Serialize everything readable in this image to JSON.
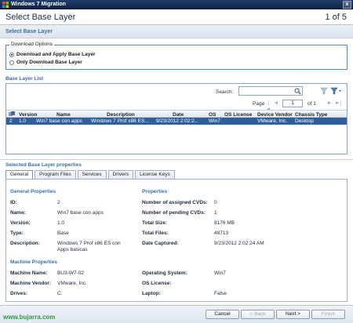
{
  "window": {
    "title": "Windows 7 Migration",
    "close_glyph": "x"
  },
  "header": {
    "title": "Select Base Layer",
    "step": "1 of 5"
  },
  "band": {
    "title": "Select Base Layer"
  },
  "download_options": {
    "legend": "Download Options",
    "options": [
      {
        "label": "Download and Apply Base Layer",
        "selected": true
      },
      {
        "label": "Only Download Base Layer",
        "selected": false
      }
    ]
  },
  "base_layer_list": {
    "title": "Base Layer List",
    "search_label": "Search:",
    "search_value": "",
    "pager": {
      "label": "Page",
      "first": "|◄",
      "prev": "◄",
      "page": "1",
      "of": "of 1",
      "next": "►",
      "last": "►|"
    },
    "columns": [
      "",
      "Version",
      "Name",
      "Description",
      "Date",
      "OS",
      "OS License",
      "Device Vendor",
      "Chassis Type"
    ],
    "rows": [
      [
        "2",
        "1.0",
        "Win7 base con apps",
        "Windows 7 Prof x86 ES...",
        "9/23/2012 2:02:2...",
        "Win7",
        "",
        "VMware, Inc.",
        "Desktop"
      ]
    ]
  },
  "selected_props": {
    "title": "Selected Base Layer properties",
    "tabs": [
      "General",
      "Program Files",
      "Services",
      "Drivers",
      "License Keys"
    ],
    "active_tab": "General",
    "general_heading": "General Properties",
    "properties_heading": "Properties",
    "machine_heading": "Machine Properties",
    "general": [
      {
        "k": "ID:",
        "v": "2"
      },
      {
        "k": "Name:",
        "v": "Win7 base con apps"
      },
      {
        "k": "Version:",
        "v": "1.0"
      },
      {
        "k": "Type:",
        "v": "Base"
      },
      {
        "k": "Description:",
        "v": "Windows 7 Prof x86 ES con",
        "v2": "Apps basicas"
      }
    ],
    "properties": [
      {
        "k": "Number of assigned CVDs:",
        "v": "0"
      },
      {
        "k": "Number of pending CVDs:",
        "v": "1"
      },
      {
        "k": "Total Size:",
        "v": "8176 MB"
      },
      {
        "k": "Total Files:",
        "v": "48713"
      },
      {
        "k": "Date Captured:",
        "v": "9/23/2012 2:02:24 AM"
      }
    ],
    "machine_left": [
      {
        "k": "Machine Name:",
        "v": "BU3-W7-02"
      },
      {
        "k": "Machine Vendor:",
        "v": "VMware, Inc."
      },
      {
        "k": "Drives:",
        "v": "C:"
      }
    ],
    "machine_right": [
      {
        "k": "Operating System:",
        "v": "Win7"
      },
      {
        "k": "OS License:",
        "v": ""
      },
      {
        "k": "Laptop:",
        "v": "False"
      }
    ]
  },
  "footer": {
    "cancel": "Cancel",
    "back": "< Back",
    "next": "Next >",
    "finish": "Finish"
  },
  "watermark": "www.bujarra.com"
}
